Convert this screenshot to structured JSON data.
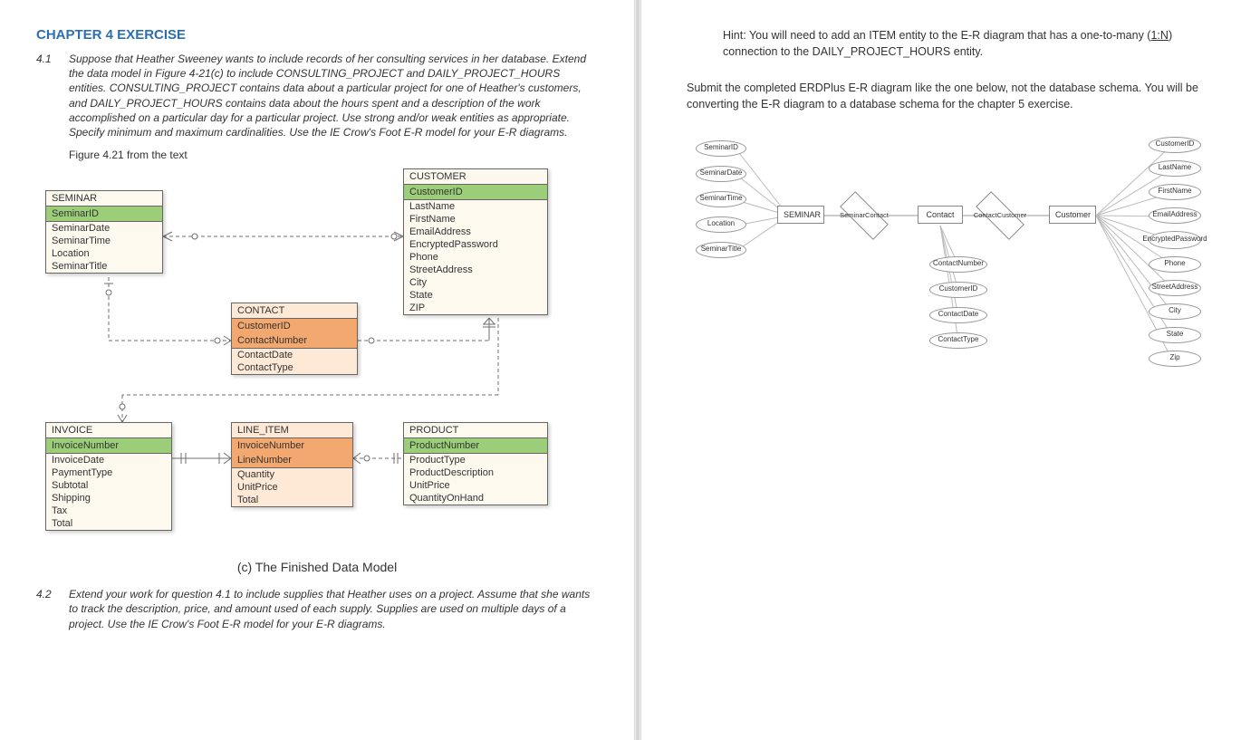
{
  "left": {
    "chapter_title": "CHAPTER 4 EXERCISE",
    "ex41_num": "4.1",
    "ex41_body": "Suppose that Heather Sweeney wants to include records of her consulting services in her database.  Extend the data model in Figure 4-21(c) to include CONSULTING_PROJECT and DAILY_PROJECT_HOURS entities.  CONSULTING_PROJECT contains data about a particular project for one of Heather's customers, and DAILY_PROJECT_HOURS contains data about the hours spent and a description of the work accomplished on a particular day for a particular project. Use strong and/or weak entities as appropriate.  Specify minimum and maximum cardinalities.  Use the IE Crow's Foot E-R model for your E-R diagrams.",
    "figure_caption": "Figure 4.21 from the text",
    "diagram_caption": "(c) The Finished Data Model",
    "ex42_num": "4.2",
    "ex42_body": "Extend your work for question 4.1 to include supplies that Heather uses on a project. Assume that she wants to track the description, price, and amount used of each supply. Supplies are used on multiple days of a project. Use the IE Crow's Foot E-R model for your E-R diagrams.",
    "entities": {
      "seminar": {
        "title": "SEMINAR",
        "key": "SeminarID",
        "attrs": [
          "SeminarDate",
          "SeminarTime",
          "Location",
          "SeminarTitle"
        ]
      },
      "customer": {
        "title": "CUSTOMER",
        "key": "CustomerID",
        "attrs": [
          "LastName",
          "FirstName",
          "EmailAddress",
          "EncryptedPassword",
          "Phone",
          "StreetAddress",
          "City",
          "State",
          "ZIP"
        ]
      },
      "contact": {
        "title": "CONTACT",
        "key1": "CustomerID",
        "key2": "ContactNumber",
        "attrs": [
          "ContactDate",
          "ContactType"
        ]
      },
      "invoice": {
        "title": "INVOICE",
        "key": "InvoiceNumber",
        "attrs": [
          "InvoiceDate",
          "PaymentType",
          "Subtotal",
          "Shipping",
          "Tax",
          "Total"
        ]
      },
      "lineitem": {
        "title": "LINE_ITEM",
        "key1": "InvoiceNumber",
        "key2": "LineNumber",
        "attrs": [
          "Quantity",
          "UnitPrice",
          "Total"
        ]
      },
      "product": {
        "title": "PRODUCT",
        "key": "ProductNumber",
        "attrs": [
          "ProductType",
          "ProductDescription",
          "UnitPrice",
          "QuantityOnHand"
        ]
      }
    }
  },
  "right": {
    "hint_prefix": "Hint: You will need to add an ITEM entity to the E-R diagram that has a one-to-many (",
    "hint_link": "1:N",
    "hint_suffix": ") connection to the DAILY_PROJECT_HOURS entity.",
    "submit_text": "Submit the completed ERDPlus E-R diagram like the one below, not the database schema.  You will be converting the E-R diagram to a database schema for the chapter 5 exercise.",
    "chen": {
      "entities": {
        "seminar": "SEMINAR",
        "contact": "Contact",
        "customer": "Customer"
      },
      "relationships": {
        "sc": "SeminarContact",
        "cc": "ContactCustomer"
      },
      "seminar_attrs": [
        "SeminarID",
        "SeminarDate",
        "SeminarTime",
        "Location",
        "SeminarTitle"
      ],
      "contact_attrs": [
        "ContactNumber",
        "CustomerID",
        "ContactDate",
        "ContactType"
      ],
      "customer_attrs": [
        "CustomerID",
        "LastName",
        "FirstName",
        "EmailAddress",
        "EncryptedPassword",
        "Phone",
        "StreetAddress",
        "City",
        "State",
        "Zip"
      ]
    }
  }
}
